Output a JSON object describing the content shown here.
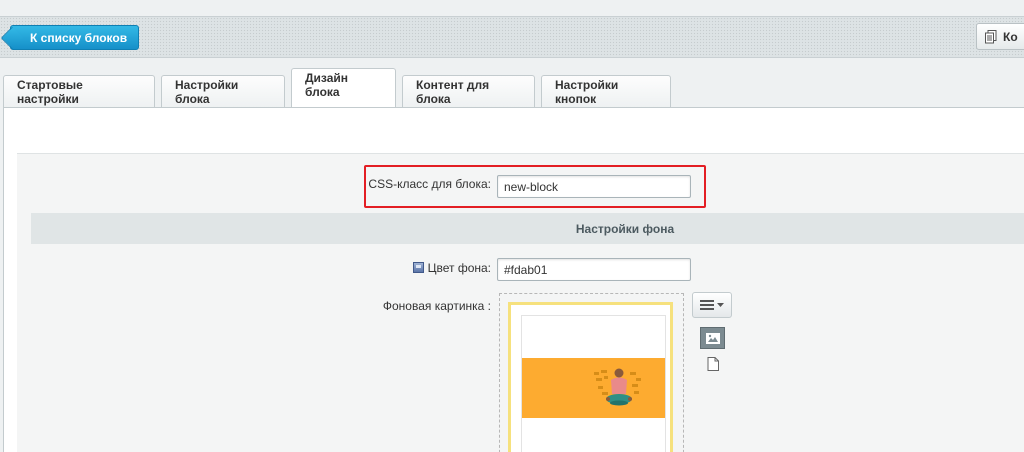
{
  "toolbar": {
    "back_label": "К списку блоков",
    "right_label": "Ко"
  },
  "tabs": [
    {
      "label": "Стартовые настройки",
      "active": false
    },
    {
      "label": "Настройки блока",
      "active": false
    },
    {
      "label": "Дизайн блока",
      "active": true
    },
    {
      "label": "Контент для блока",
      "active": false
    },
    {
      "label": "Настройки кнопок",
      "active": false
    }
  ],
  "form": {
    "css_class_label": "CSS-класс для блока:",
    "css_class_value": "new-block",
    "section_title": "Настройки фона",
    "bg_color_label": "Цвет фона:",
    "bg_color_value": "#fdab01",
    "bg_image_label": "Фоновая картинка :"
  },
  "colors": {
    "accent": "#1690c9",
    "highlight_border": "#e31e24",
    "banner": "#fdab30"
  },
  "icons": [
    "copy-icon",
    "help-icon",
    "hamburger-menu-icon",
    "caret-down-icon",
    "image-icon",
    "file-icon"
  ]
}
